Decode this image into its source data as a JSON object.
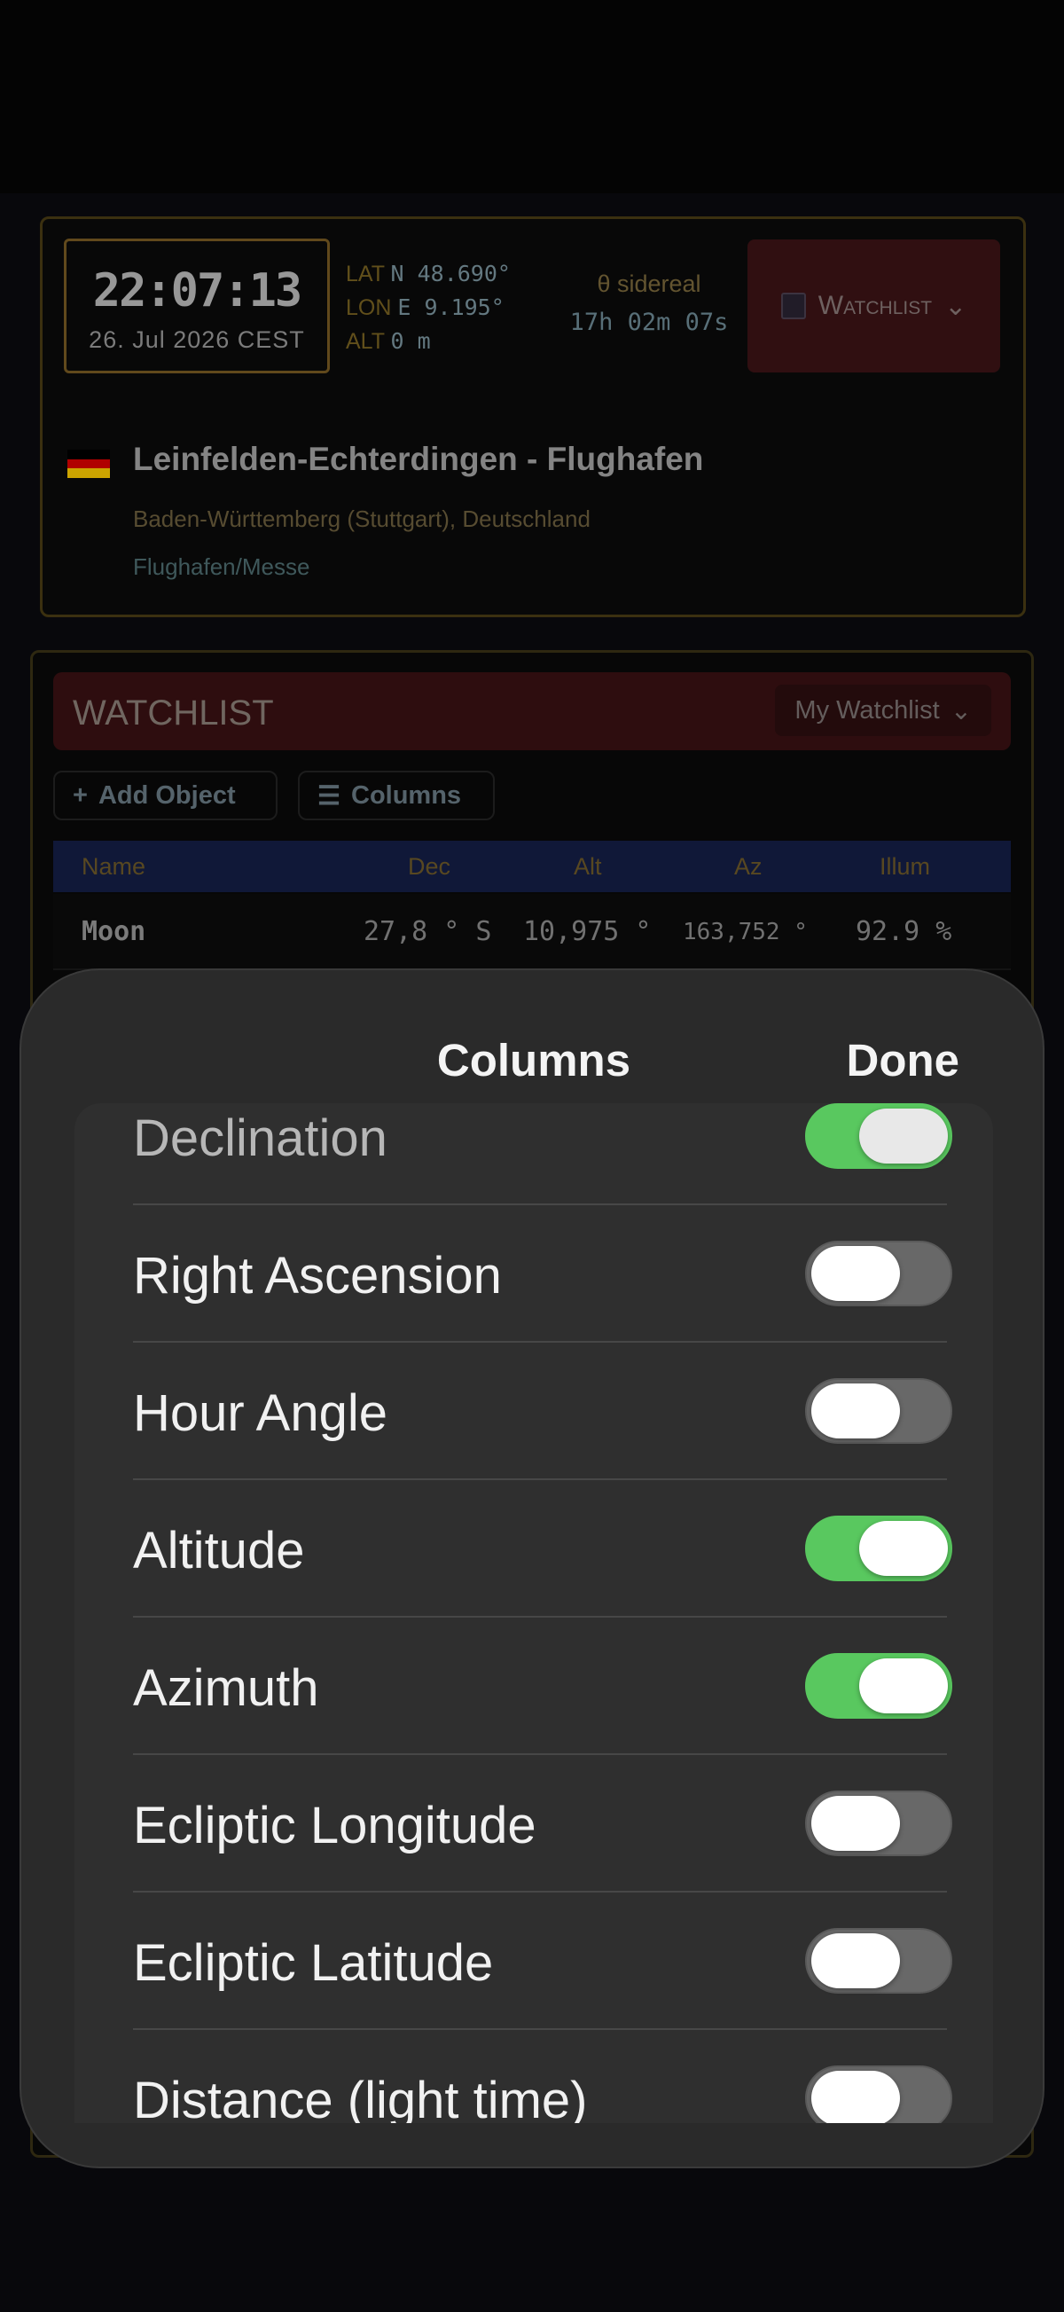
{
  "clock": {
    "time": "22:07:13",
    "date": "26. Jul 2026  CEST"
  },
  "coords": {
    "lat_label": "LAT",
    "lat_value": "N 48.690°",
    "lon_label": "LON",
    "lon_value": "E 9.195°",
    "alt_label": "ALT",
    "alt_value": "0 m"
  },
  "sidereal": {
    "label": "θ sidereal",
    "value": "17h 02m 07s"
  },
  "watchlist_button": {
    "label": "Watchlist"
  },
  "location": {
    "name": "Leinfelden-Echterdingen - Flughafen",
    "region": "Baden-Württemberg (Stuttgart), Deutschland",
    "district": "Flughafen/Messe",
    "flag_colors": [
      "#000000",
      "#dd0000",
      "#ffce00"
    ]
  },
  "watchlist": {
    "title": "WATCHLIST",
    "selected_list": "My Watchlist",
    "add_object_label": "Add Object",
    "columns_label": "Columns",
    "table": {
      "headers": [
        "Name",
        "Dec",
        "Alt",
        "Az",
        "Illum"
      ],
      "rows": [
        {
          "name": "Moon",
          "dec": "27,8 ° S",
          "alt": "10,975 °",
          "az": "163,752 °",
          "illum": "92.9 %"
        }
      ]
    }
  },
  "sheet": {
    "title": "Columns",
    "done_label": "Done",
    "items": [
      {
        "label": "Declination",
        "on": true
      },
      {
        "label": "Right Ascension",
        "on": false
      },
      {
        "label": "Hour Angle",
        "on": false
      },
      {
        "label": "Altitude",
        "on": true
      },
      {
        "label": "Azimuth",
        "on": true
      },
      {
        "label": "Ecliptic Longitude",
        "on": false
      },
      {
        "label": "Ecliptic Latitude",
        "on": false
      },
      {
        "label": "Distance (light time)",
        "on": false
      }
    ]
  },
  "colors": {
    "toggle_on": "#59c85f",
    "toggle_off": "#686868",
    "accent_gold": "#7a5c23"
  }
}
